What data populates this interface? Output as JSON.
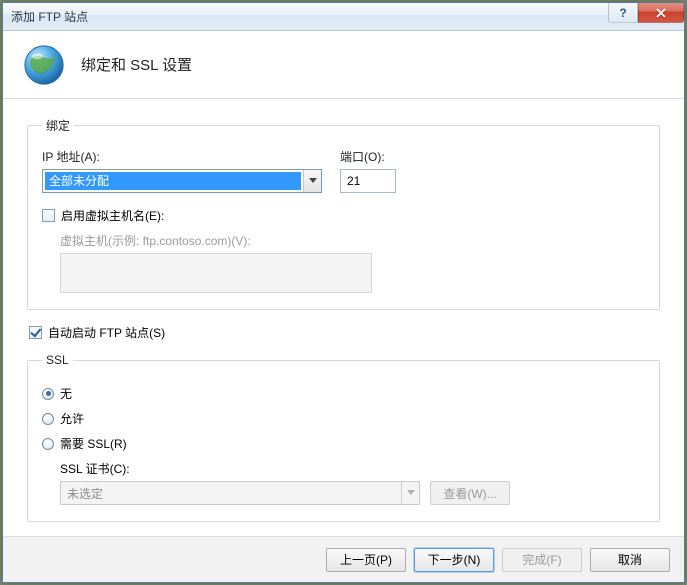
{
  "window": {
    "title": "添加 FTP 站点"
  },
  "header": {
    "title": "绑定和 SSL 设置"
  },
  "binding": {
    "legend": "绑定",
    "ip_label": "IP 地址(A):",
    "ip_value": "全部未分配",
    "port_label": "端口(O):",
    "port_value": "21",
    "enable_vhost_label": "启用虚拟主机名(E):",
    "enable_vhost_checked": false,
    "vhost_label": "虚拟主机(示例: ftp.contoso.com)(V):",
    "vhost_value": ""
  },
  "auto_start": {
    "label": "自动启动 FTP 站点(S)",
    "checked": true
  },
  "ssl": {
    "legend": "SSL",
    "opt_none": "无",
    "opt_allow": "允许",
    "opt_require": "需要 SSL(R)",
    "selected": "none",
    "cert_label": "SSL 证书(C):",
    "cert_value": "未选定",
    "view_btn": "查看(W)..."
  },
  "footer": {
    "prev": "上一页(P)",
    "next": "下一步(N)",
    "finish": "完成(F)",
    "cancel": "取消"
  },
  "titlebar_help": "?"
}
